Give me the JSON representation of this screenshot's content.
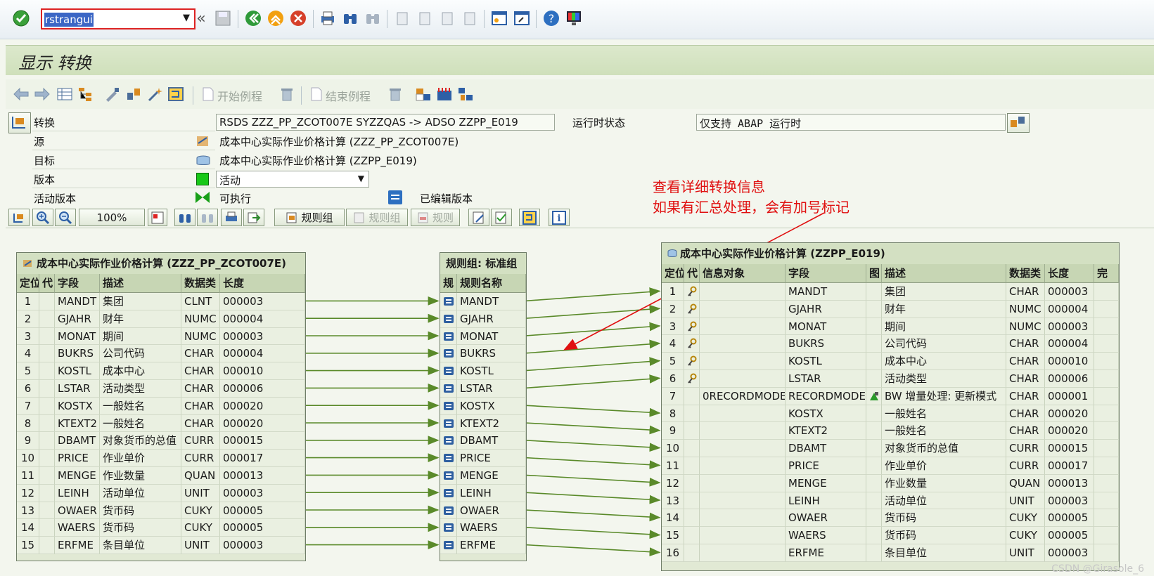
{
  "command_field": {
    "value": "rstrangui"
  },
  "title": "显示 转换",
  "app_toolbar": {
    "start_routine_label": "开始例程",
    "end_routine_label": "结束例程"
  },
  "header": {
    "transformation_label": "转换",
    "transformation_value": "RSDS ZZZ_PP_ZCOT007E SYZZQAS -> ADSO ZZPP_E019",
    "runtime_status_label": "运行时状态",
    "runtime_status_value": "仅支持 ABAP 运行时",
    "source_label": "源",
    "source_value": "成本中心实际作业价格计算 (ZZZ_PP_ZCOT007E)",
    "target_label": "目标",
    "target_value": "成本中心实际作业价格计算 (ZZPP_E019)",
    "version_label": "版本",
    "version_value": "活动",
    "active_version_label": "活动版本",
    "executable_label": "可执行",
    "edited_version_label": "已编辑版本"
  },
  "grid_toolbar": {
    "zoom": "100%",
    "rule_group_label": "规则组",
    "rule_group_label2": "规则组",
    "rule_label": "规则"
  },
  "annotation": {
    "line1": "查看详细转换信息",
    "line2": "如果有汇总处理，会有加号标记"
  },
  "source_table": {
    "title": "成本中心实际作业价格计算 (ZZZ_PP_ZCOT007E)",
    "headers": [
      "定位",
      "代",
      "字段",
      "描述",
      "数据类",
      "长度"
    ],
    "rows": [
      [
        "1",
        "",
        "MANDT",
        "集团",
        "CLNT",
        "000003"
      ],
      [
        "2",
        "",
        "GJAHR",
        "财年",
        "NUMC",
        "000004"
      ],
      [
        "3",
        "",
        "MONAT",
        "期间",
        "NUMC",
        "000003"
      ],
      [
        "4",
        "",
        "BUKRS",
        "公司代码",
        "CHAR",
        "000004"
      ],
      [
        "5",
        "",
        "KOSTL",
        "成本中心",
        "CHAR",
        "000010"
      ],
      [
        "6",
        "",
        "LSTAR",
        "活动类型",
        "CHAR",
        "000006"
      ],
      [
        "7",
        "",
        "KOSTX",
        "一般姓名",
        "CHAR",
        "000020"
      ],
      [
        "8",
        "",
        "KTEXT2",
        "一般姓名",
        "CHAR",
        "000020"
      ],
      [
        "9",
        "",
        "DBAMT",
        "对象货币的总值",
        "CURR",
        "000015"
      ],
      [
        "10",
        "",
        "PRICE",
        "作业单价",
        "CURR",
        "000017"
      ],
      [
        "11",
        "",
        "MENGE",
        "作业数量",
        "QUAN",
        "000013"
      ],
      [
        "12",
        "",
        "LEINH",
        "活动单位",
        "UNIT",
        "000003"
      ],
      [
        "13",
        "",
        "OWAER",
        "货币码",
        "CUKY",
        "000005"
      ],
      [
        "14",
        "",
        "WAERS",
        "货币码",
        "CUKY",
        "000005"
      ],
      [
        "15",
        "",
        "ERFME",
        "条目单位",
        "UNIT",
        "000003"
      ]
    ]
  },
  "rule_group": {
    "title": "规则组: 标准组",
    "headers": [
      "规",
      "规则名称"
    ],
    "rules": [
      "MANDT",
      "GJAHR",
      "MONAT",
      "BUKRS",
      "KOSTL",
      "LSTAR",
      "KOSTX",
      "KTEXT2",
      "DBAMT",
      "PRICE",
      "MENGE",
      "LEINH",
      "OWAER",
      "WAERS",
      "ERFME"
    ]
  },
  "target_table": {
    "title": "成本中心实际作业价格计算 (ZZPP_E019)",
    "headers": [
      "定位",
      "代",
      "信息对象",
      "字段",
      "图",
      "描述",
      "数据类",
      "长度",
      "完"
    ],
    "rows": [
      [
        "1",
        "key",
        "",
        "MANDT",
        "",
        "集团",
        "CHAR",
        "000003"
      ],
      [
        "2",
        "key",
        "",
        "GJAHR",
        "",
        "财年",
        "NUMC",
        "000004"
      ],
      [
        "3",
        "key",
        "",
        "MONAT",
        "",
        "期间",
        "NUMC",
        "000003"
      ],
      [
        "4",
        "key",
        "",
        "BUKRS",
        "",
        "公司代码",
        "CHAR",
        "000004"
      ],
      [
        "5",
        "key",
        "",
        "KOSTL",
        "",
        "成本中心",
        "CHAR",
        "000010"
      ],
      [
        "6",
        "key",
        "",
        "LSTAR",
        "",
        "活动类型",
        "CHAR",
        "000006"
      ],
      [
        "7",
        "",
        "0RECORDMODE",
        "RECORDMODE",
        "icon",
        "BW 增量处理: 更新模式",
        "CHAR",
        "000001"
      ],
      [
        "8",
        "",
        "",
        "KOSTX",
        "",
        "一般姓名",
        "CHAR",
        "000020"
      ],
      [
        "9",
        "",
        "",
        "KTEXT2",
        "",
        "一般姓名",
        "CHAR",
        "000020"
      ],
      [
        "10",
        "",
        "",
        "DBAMT",
        "",
        "对象货币的总值",
        "CURR",
        "000015"
      ],
      [
        "11",
        "",
        "",
        "PRICE",
        "",
        "作业单价",
        "CURR",
        "000017"
      ],
      [
        "12",
        "",
        "",
        "MENGE",
        "",
        "作业数量",
        "QUAN",
        "000013"
      ],
      [
        "13",
        "",
        "",
        "LEINH",
        "",
        "活动单位",
        "UNIT",
        "000003"
      ],
      [
        "14",
        "",
        "",
        "OWAER",
        "",
        "货币码",
        "CUKY",
        "000005"
      ],
      [
        "15",
        "",
        "",
        "WAERS",
        "",
        "货币码",
        "CUKY",
        "000005"
      ],
      [
        "16",
        "",
        "",
        "ERFME",
        "",
        "条目单位",
        "UNIT",
        "000003"
      ]
    ]
  },
  "mapping": [
    [
      1,
      1
    ],
    [
      2,
      2
    ],
    [
      3,
      3
    ],
    [
      4,
      4
    ],
    [
      5,
      5
    ],
    [
      6,
      6
    ],
    [
      7,
      8
    ],
    [
      8,
      9
    ],
    [
      9,
      10
    ],
    [
      10,
      11
    ],
    [
      11,
      12
    ],
    [
      12,
      13
    ],
    [
      13,
      14
    ],
    [
      14,
      15
    ],
    [
      15,
      16
    ]
  ],
  "watermark": "CSDN @Girasole_6",
  "colors": {
    "arrow": "#5a8a2a",
    "annotation": "#e01010"
  }
}
